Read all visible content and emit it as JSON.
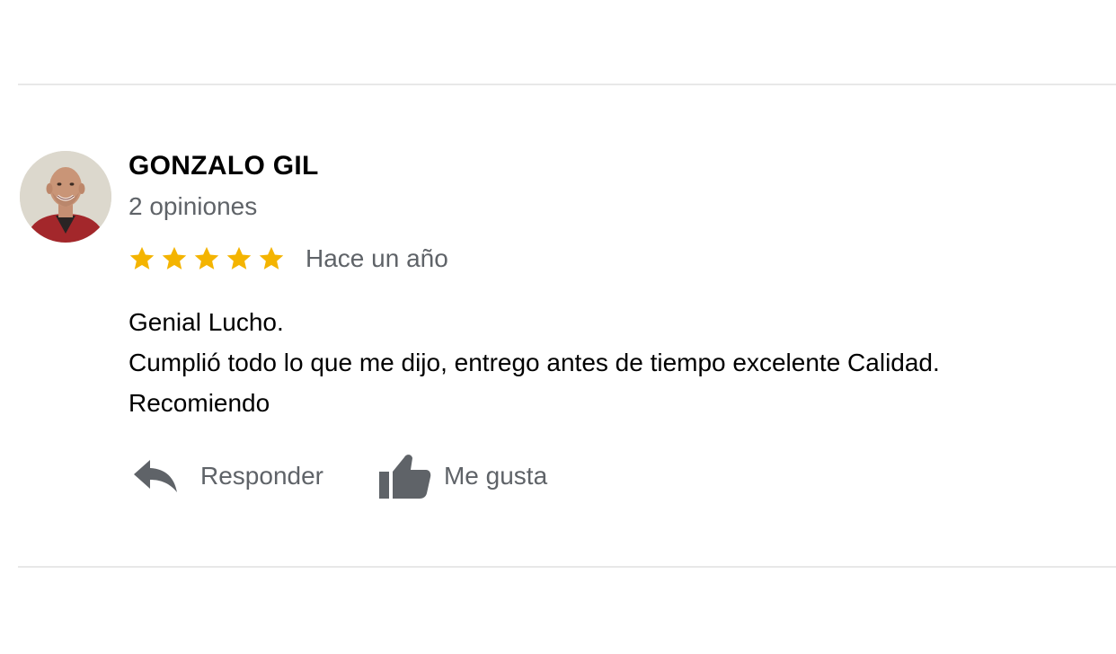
{
  "review": {
    "author": "GONZALO GIL",
    "reviews_count": "2 opiniones",
    "rating": 5,
    "rating_max": 5,
    "star_color": "#F4B400",
    "time_ago": "Hace un año",
    "body_lines": [
      "Genial Lucho.",
      "Cumplió todo lo que me dijo, entrego antes de tiempo excelente Calidad.",
      "Recomiendo"
    ],
    "actions": {
      "reply_label": "Responder",
      "reply_icon": "reply-arrow-icon",
      "like_label": "Me gusta",
      "like_icon": "thumbs-up-icon"
    }
  }
}
